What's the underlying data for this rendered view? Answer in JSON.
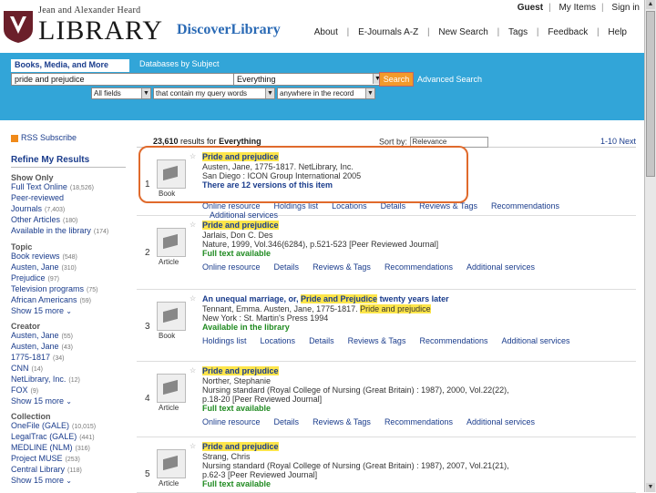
{
  "utility": {
    "guest": "Guest",
    "my_items": "My Items",
    "sign_in": "Sign in"
  },
  "header": {
    "logo_sub": "Jean and Alexander Heard",
    "logo_main": "LIBRARY",
    "logo_shield_text": "VANDERBILT",
    "discover": "DiscoverLibrary",
    "nav": [
      "About",
      "E-Journals A-Z",
      "New Search",
      "Tags",
      "Feedback",
      "Help"
    ]
  },
  "search": {
    "tab_active": "Books, Media, and More",
    "tab_inactive": "Databases by Subject",
    "query": "pride and prejudice",
    "scope": "Everything",
    "button": "Search",
    "advanced": "Advanced Search",
    "filter_field": "All fields",
    "filter_match": "that contain my query words",
    "filter_scope": "anywhere in the record"
  },
  "results_header": {
    "count": "23,610",
    "count_suffix": "results for",
    "query_label": "Everything",
    "sort_label": "Sort by:",
    "sort_value": "Relevance",
    "pager": "1-10 Next"
  },
  "sidebar": {
    "rss": "RSS Subscribe",
    "refine": "Refine My Results",
    "show_only": {
      "heading": "Show Only",
      "items": [
        {
          "label": "Full Text Online",
          "count": "(18,526)"
        },
        {
          "label": "Peer-reviewed",
          "count": ""
        },
        {
          "label": "Journals",
          "count": "(7,403)"
        },
        {
          "label": "Other Articles",
          "count": "(180)"
        },
        {
          "label": "Available in the library",
          "count": "(174)"
        }
      ]
    },
    "topic": {
      "heading": "Topic",
      "items": [
        {
          "label": "Book reviews",
          "count": "(548)"
        },
        {
          "label": "Austen, Jane",
          "count": "(310)"
        },
        {
          "label": "Prejudice",
          "count": "(97)"
        },
        {
          "label": "Television programs",
          "count": "(75)"
        },
        {
          "label": "African Americans",
          "count": "(59)"
        }
      ],
      "show_more": "Show 15 more"
    },
    "creator": {
      "heading": "Creator",
      "items": [
        {
          "label": "Austen, Jane",
          "count": "(55)"
        },
        {
          "label": "Austen, Jane",
          "count": "(43)"
        },
        {
          "label": "1775-1817",
          "count": "(34)"
        },
        {
          "label": "CNN",
          "count": "(14)"
        },
        {
          "label": "NetLibrary, Inc.",
          "count": "(12)"
        },
        {
          "label": "FOX",
          "count": "(9)"
        }
      ],
      "show_more": "Show 15 more"
    },
    "collection": {
      "heading": "Collection",
      "items": [
        {
          "label": "OneFile (GALE)",
          "count": "(10,015)"
        },
        {
          "label": "LegalTrac (GALE)",
          "count": "(441)"
        },
        {
          "label": "MEDLINE (NLM)",
          "count": "(316)"
        },
        {
          "label": "Project MUSE",
          "count": "(253)"
        },
        {
          "label": "Central Library",
          "count": "(118)"
        }
      ],
      "show_more": "Show 15 more"
    }
  },
  "results": [
    {
      "num": "1",
      "type": "Book",
      "title_parts": [
        {
          "t": "Pride and prejudice",
          "hl": true
        }
      ],
      "lines": [
        "Austen, Jane, 1775-1817. NetLibrary, Inc.",
        "San Diego : ICON Group International 2005"
      ],
      "versions": "There are 12 versions of this item",
      "actions": [
        "Online resource",
        "Holdings list",
        "Locations",
        "Details",
        "Reviews & Tags",
        "Recommendations"
      ],
      "actions2": [
        "Additional services"
      ]
    },
    {
      "num": "2",
      "type": "Article",
      "title_parts": [
        {
          "t": "Pride and prejudice",
          "hl": true
        }
      ],
      "lines": [
        "Jarlais, Don C. Des",
        "Nature, 1999, Vol.346(6284), p.521-523 [Peer Reviewed Journal]"
      ],
      "status": "Full text available",
      "actions": [
        "Online resource",
        "Details",
        "Reviews & Tags",
        "Recommendations",
        "Additional services"
      ]
    },
    {
      "num": "3",
      "type": "Book",
      "title_parts": [
        {
          "t": "An unequal marriage, or, ",
          "hl": false
        },
        {
          "t": "Pride and Prejudice",
          "hl": true
        },
        {
          "t": " twenty years later",
          "hl": false
        }
      ],
      "line_parts": [
        {
          "t": "Tennant, Emma. Austen, Jane, 1775-1817. ",
          "hl": false
        },
        {
          "t": "Pride and prejudice",
          "hl": true
        }
      ],
      "lines": [
        "New York : St. Martin's Press 1994"
      ],
      "status": "Available in the library",
      "actions": [
        "Holdings list",
        "Locations",
        "Details",
        "Reviews & Tags",
        "Recommendations",
        "Additional services"
      ]
    },
    {
      "num": "4",
      "type": "Article",
      "title_parts": [
        {
          "t": "Pride and prejudice",
          "hl": true
        }
      ],
      "lines": [
        "Norther, Stephanie",
        "Nursing standard (Royal College of Nursing (Great Britain) : 1987), 2000, Vol.22(22),",
        "p.18-20 [Peer Reviewed Journal]"
      ],
      "status": "Full text available",
      "actions": [
        "Online resource",
        "Details",
        "Reviews & Tags",
        "Recommendations",
        "Additional services"
      ]
    },
    {
      "num": "5",
      "type": "Article",
      "title_parts": [
        {
          "t": "Pride and prejudice",
          "hl": true
        }
      ],
      "lines": [
        "Strang, Chris",
        "Nursing standard (Royal College of Nursing (Great Britain) : 1987), 2007, Vol.21(21),",
        "p.62-3 [Peer Reviewed Journal]"
      ],
      "status": "Full text available"
    }
  ]
}
